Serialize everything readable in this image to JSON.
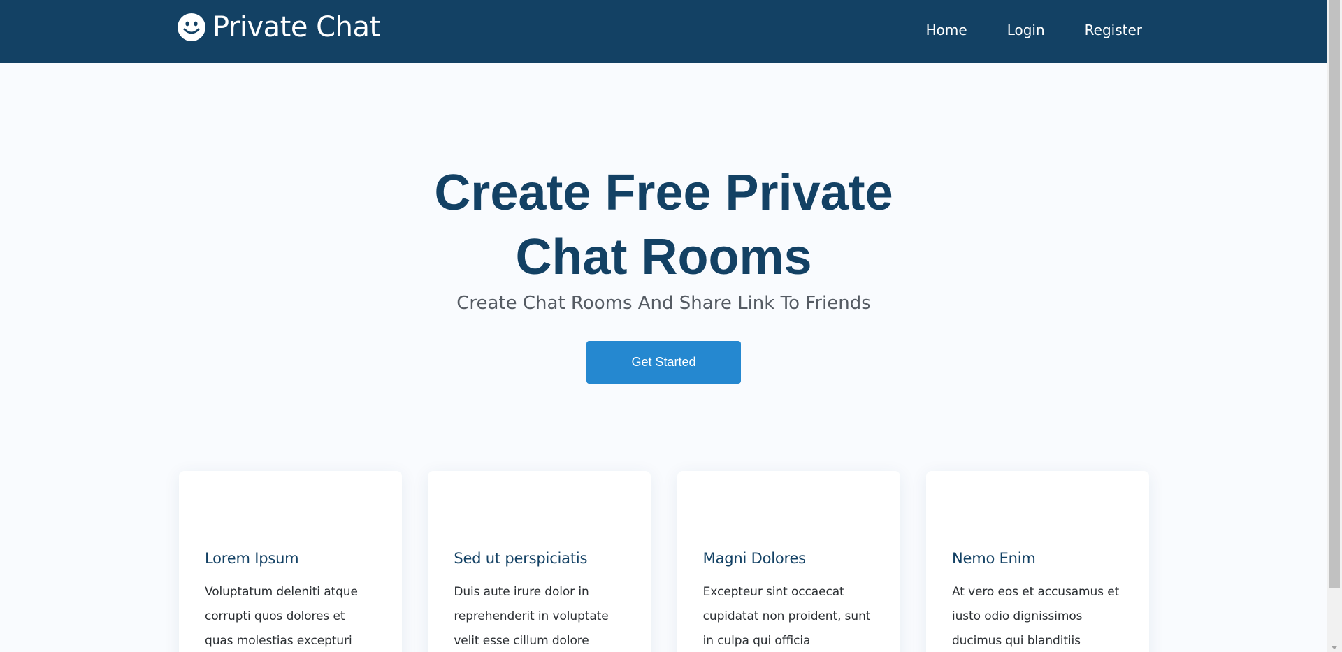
{
  "header": {
    "brand": "Private Chat",
    "brand_icon": "smiley-icon",
    "nav": [
      {
        "label": "Home"
      },
      {
        "label": "Login"
      },
      {
        "label": "Register"
      }
    ]
  },
  "hero": {
    "title": "Create Free Private Chat Rooms",
    "subtitle": "Create Chat Rooms And Share Link To Friends",
    "cta": "Get Started"
  },
  "cards": [
    {
      "title": "Lorem Ipsum",
      "text": "Voluptatum deleniti atque corrupti quos dolores et quas molestias excepturi"
    },
    {
      "title": "Sed ut perspiciatis",
      "text": "Duis aute irure dolor in reprehenderit in voluptate velit esse cillum dolore"
    },
    {
      "title": "Magni Dolores",
      "text": "Excepteur sint occaecat cupidatat non proident, sunt in culpa qui officia"
    },
    {
      "title": "Nemo Enim",
      "text": "At vero eos et accusamus et iusto odio dignissimos ducimus qui blanditiis"
    }
  ],
  "colors": {
    "navbar": "#134164",
    "accent": "#2588d0",
    "title": "#134164",
    "background": "#f9fbfe"
  }
}
